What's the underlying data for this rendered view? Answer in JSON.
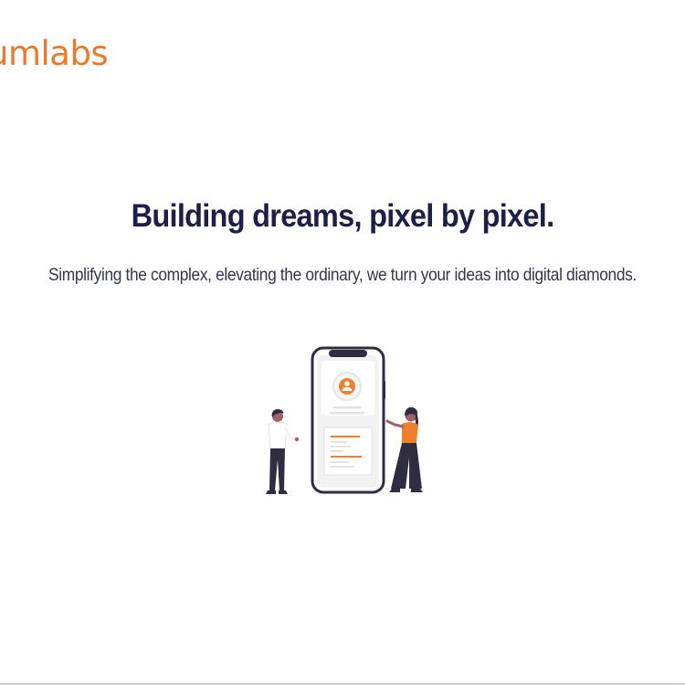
{
  "header": {
    "logo_text": "umlabs"
  },
  "hero": {
    "title": "Building dreams, pixel by pixel.",
    "subtitle": "Simplifying the complex, elevating the ordinary, we turn your ideas into digital diamonds."
  },
  "colors": {
    "brand": "#ea7a2c",
    "heading": "#1c2046",
    "body_text": "#34364a",
    "illustration_dark": "#2f2e41"
  },
  "illustration": {
    "icon": "people-with-phone-illustration"
  }
}
